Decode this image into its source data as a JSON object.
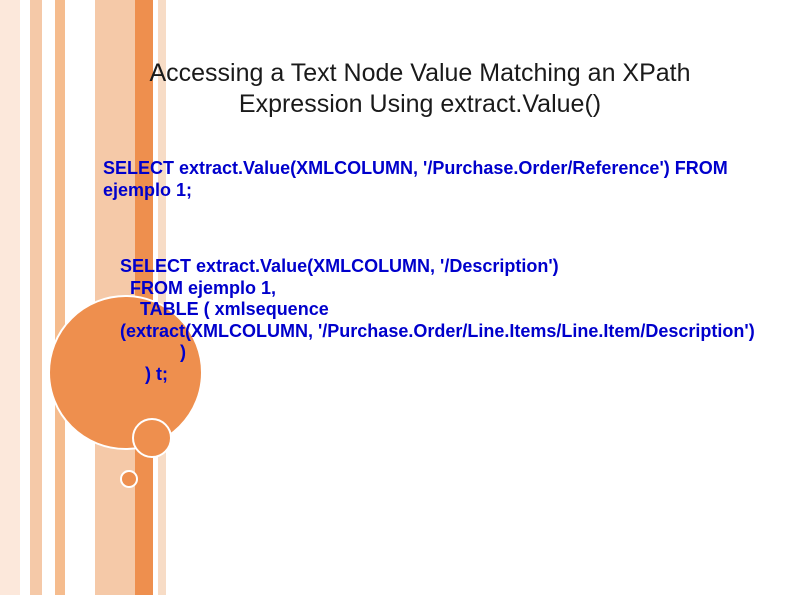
{
  "title": "Accessing a Text Node Value Matching an XPath Expression Using extract.Value()",
  "code1_line1": "SELECT extract.Value(XMLCOLUMN, '/Purchase.Order/Reference') FROM ejemplo 1;",
  "code2_line1": "SELECT extract.Value(XMLCOLUMN, '/Description')",
  "code2_line2": "  FROM ejemplo 1,",
  "code2_line3": "    TABLE ( xmlsequence",
  "code2_line4": "(extract(XMLCOLUMN, '/Purchase.Order/Line.Items/Line.Item/Description')",
  "code2_line5": "            )",
  "code2_line6": "     ) t;"
}
